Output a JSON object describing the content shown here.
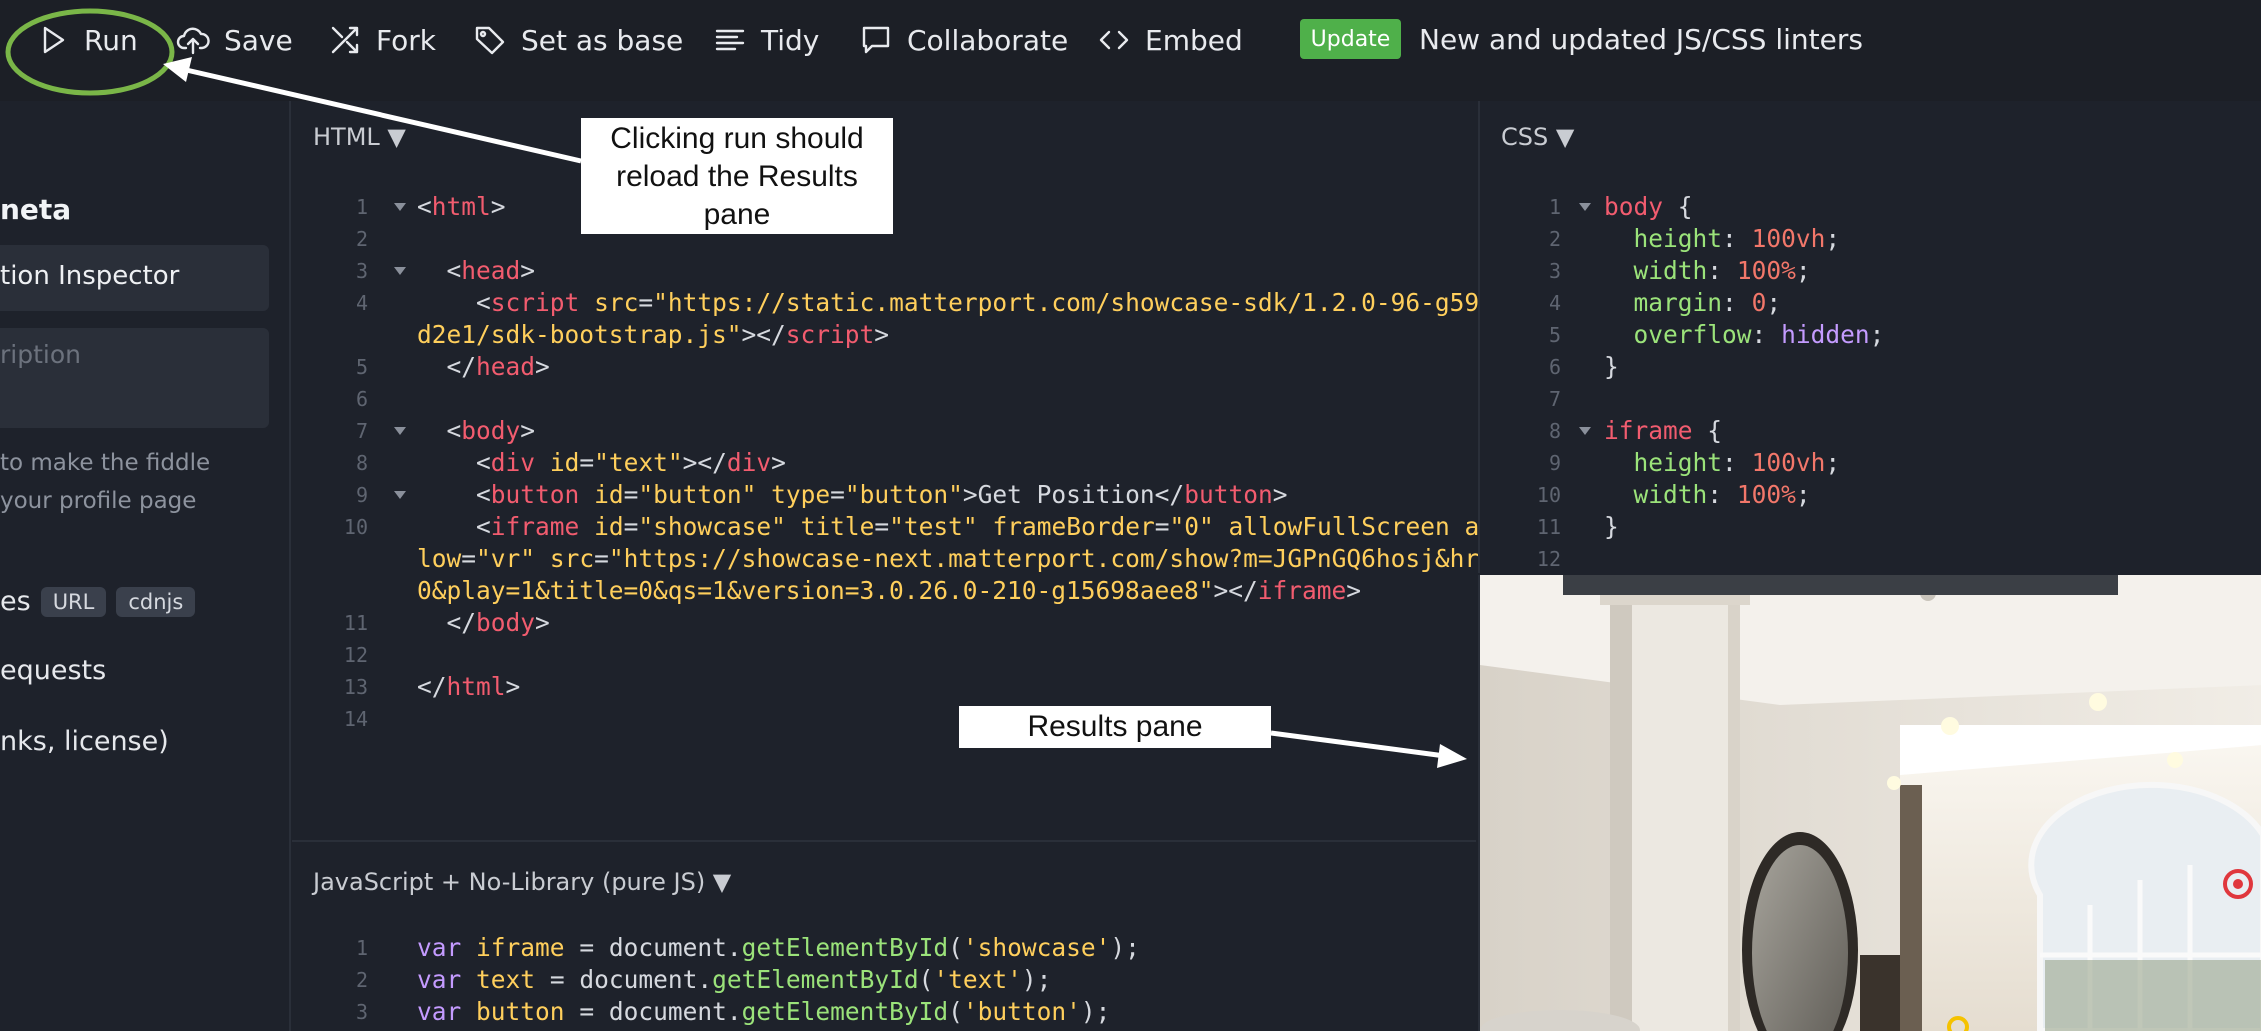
{
  "toolbar": {
    "run": "Run",
    "save": "Save",
    "fork": "Fork",
    "set_as_base": "Set as base",
    "tidy": "Tidy",
    "collaborate": "Collaborate",
    "embed": "Embed",
    "update_badge": "Update",
    "announcement": "New and updated JS/CSS linters"
  },
  "sidebar": {
    "heading": "neta",
    "title_value": "tion Inspector",
    "description_placeholder": "ription",
    "note_line1": "to make the fiddle",
    "note_line2": "your profile page",
    "resources_label": "es",
    "chip_url": "URL",
    "chip_cdnjs": "cdnjs",
    "requests": "equests",
    "links": "nks, license)"
  },
  "panes": {
    "html_title": "HTML ▼",
    "css_title": "CSS ▼",
    "js_title": "JavaScript + No-Library (pure JS) ▼"
  },
  "annotations": {
    "run_line1": "Clicking run should",
    "run_line2": "reload the Results",
    "run_line3": "pane",
    "results": "Results pane"
  },
  "colors": {
    "toolbar_bg": "#1c1f26",
    "editor_bg": "#1e222b",
    "update_badge": "#4fb04a",
    "annotation_circle": "#7ab648"
  }
}
